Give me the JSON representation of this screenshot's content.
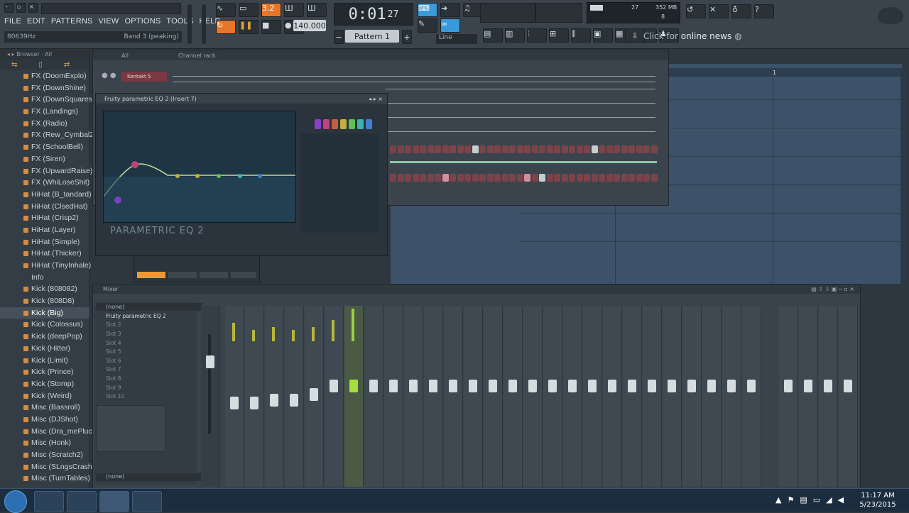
{
  "app": {
    "menu": [
      "FILE",
      "EDIT",
      "PATTERNS",
      "VIEW",
      "OPTIONS",
      "TOOLS",
      "HELP"
    ],
    "hint_left": "80639Hz",
    "hint_right": "Band 3 (peaking)"
  },
  "transport": {
    "time_main": "0:01",
    "time_sub": "27",
    "tempo": "140.000",
    "pattern": "Pattern 1",
    "snap": "Line"
  },
  "cpu": {
    "value1": "27",
    "mem": "352 MB",
    "value2": "8"
  },
  "news": {
    "prefix": "Click for",
    "text": "online news"
  },
  "browser": {
    "items": [
      "FX (DoomExplo)",
      "FX (DownShine)",
      "FX (DownSquares)",
      "FX (Landings)",
      "FX (Radio)",
      "FX (Rew_Cymbal2)",
      "FX (SchoolBell)",
      "FX (Siren)",
      "FX (UpwardRaise)",
      "FX (WhiLoseShit)",
      "HiHat (B_tandard)",
      "HiHat (ClsedHat)",
      "HiHat (Crisp2)",
      "HiHat (Layer)",
      "HiHat (Simple)",
      "HiHat (Thicker)",
      "HiHat (TinyInhale)",
      "Info",
      "Kick (808082)",
      "Kick (808D8)",
      "Kick (Big)",
      "Kick (Colossus)",
      "Kick (deepPop)",
      "Kick (Hitter)",
      "Kick (Limit)",
      "Kick (Prince)",
      "Kick (Stomp)",
      "Kick (Weird)",
      "Misc (Bassroll)",
      "Misc (DJShot)",
      "Misc (Dra_mePluck)",
      "Misc (Honk)",
      "Misc (Scratch2)",
      "Misc (SLngsCrash)",
      "Misc (TurnTables)"
    ],
    "selected_index": 20,
    "info_index": 17
  },
  "channel_rack": {
    "title": "Channel rack",
    "channel1": "Kontakt 5",
    "filter": "All"
  },
  "eq": {
    "title": "Fruity parametric EQ 2 (Insert 7)",
    "logo": "PARAMETRIC EQ 2"
  },
  "mixer": {
    "title": "Mixer",
    "preset": "(none)",
    "first_slot": "Fruity parametric EQ 2",
    "slots": [
      "Slot 2",
      "Slot 3",
      "Slot 4",
      "Slot 5",
      "Slot 6",
      "Slot 7",
      "Slot 8",
      "Slot 9",
      "Slot 10"
    ],
    "out": "(none)"
  },
  "taskbar": {
    "time": "11:17 AM",
    "date": "5/23/2015"
  }
}
